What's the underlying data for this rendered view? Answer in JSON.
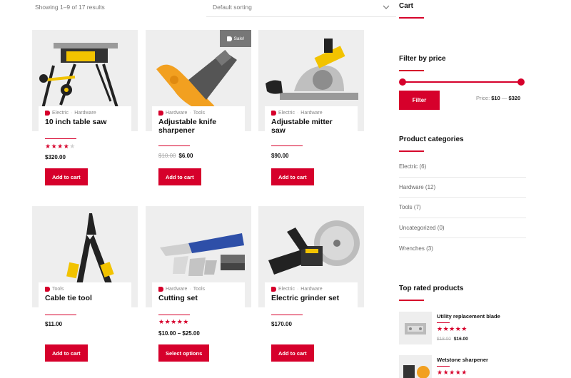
{
  "toolbar": {
    "result_count": "Showing 1–9 of 17 results",
    "sorting": "Default sorting"
  },
  "products": [
    {
      "categories": [
        "Electric",
        "Hardware"
      ],
      "title": "10 inch table saw",
      "rating": 4,
      "price": "$320.00",
      "button": "Add to cart"
    },
    {
      "categories": [
        "Hardware",
        "Tools"
      ],
      "title": "Adjustable knife sharpener",
      "sale_badge": "Sale!",
      "old_price": "$10.00",
      "price": "$6.00",
      "button": "Add to cart"
    },
    {
      "categories": [
        "Electric",
        "Hardware"
      ],
      "title": "Adjustable mitter saw",
      "price": "$90.00",
      "button": "Add to cart"
    },
    {
      "categories": [
        "Tools"
      ],
      "title": "Cable tie tool",
      "price": "$11.00",
      "button": "Add to cart"
    },
    {
      "categories": [
        "Hardware",
        "Tools"
      ],
      "title": "Cutting set",
      "rating": 5,
      "price": "$10.00 – $25.00",
      "button": "Select options"
    },
    {
      "categories": [
        "Electric",
        "Hardware"
      ],
      "title": "Electric grinder set",
      "price": "$170.00",
      "button": "Add to cart"
    }
  ],
  "sidebar": {
    "cart_title": "Cart",
    "filter": {
      "title": "Filter by price",
      "button": "Filter",
      "price_label": "Price:",
      "min": "$10",
      "separator": "—",
      "max": "$320"
    },
    "categories_title": "Product categories",
    "categories": [
      {
        "label": "Electric (6)"
      },
      {
        "label": "Hardware (12)"
      },
      {
        "label": "Tools (7)"
      },
      {
        "label": "Uncategorized (0)"
      },
      {
        "label": "Wrenches (3)"
      }
    ],
    "top_rated_title": "Top rated products",
    "top_rated": [
      {
        "name": "Utility replacement blade",
        "rating": 5,
        "old_price": "$18.00",
        "price": "$16.00"
      },
      {
        "name": "Wetstone sharpener",
        "rating": 5
      }
    ]
  },
  "colors": {
    "accent": "#d6002b",
    "image_bg": "#eeeeee"
  },
  "icons": {
    "sorting": "chevron-down-icon",
    "category": "tag-icon",
    "sale": "tag-icon"
  }
}
